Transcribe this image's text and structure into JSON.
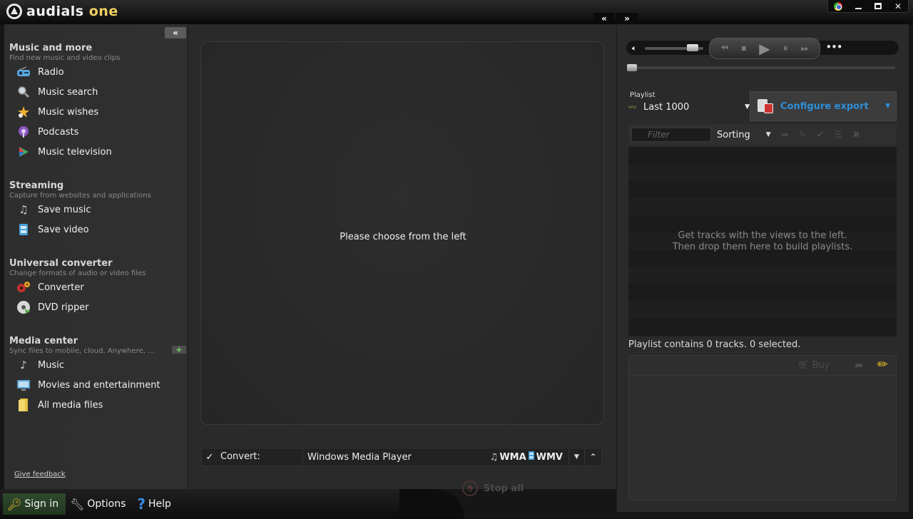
{
  "app": {
    "title_main": "audials",
    "title_accent": "one"
  },
  "window_controls": {
    "minimize": "minimize",
    "maximize": "maximize",
    "close": "✕"
  },
  "panel_toggles": {
    "left": "«",
    "right": "»",
    "sidebar_collapse": "«"
  },
  "sidebar": {
    "sections": [
      {
        "title": "Music and more",
        "subtitle": "Find new music and video clips",
        "items": [
          {
            "label": "Radio",
            "icon": "radio-icon"
          },
          {
            "label": "Music search",
            "icon": "magnifier-icon"
          },
          {
            "label": "Music wishes",
            "icon": "wishes-icon"
          },
          {
            "label": "Podcasts",
            "icon": "podcast-icon"
          },
          {
            "label": "Music television",
            "icon": "tv-play-icon"
          }
        ]
      },
      {
        "title": "Streaming",
        "subtitle": "Capture from websites and applications",
        "items": [
          {
            "label": "Save music",
            "icon": "music-note-icon"
          },
          {
            "label": "Save video",
            "icon": "film-icon"
          }
        ]
      },
      {
        "title": "Universal converter",
        "subtitle": "Change formats of audio or video files",
        "items": [
          {
            "label": "Converter",
            "icon": "converter-icon"
          },
          {
            "label": "DVD ripper",
            "icon": "dvd-icon"
          }
        ]
      },
      {
        "title": "Media center",
        "subtitle": "Sync files to mobile, cloud, Anywhere, ...",
        "add_label": "+",
        "items": [
          {
            "label": "Music",
            "icon": "music-note-icon"
          },
          {
            "label": "Movies and entertainment",
            "icon": "monitor-icon"
          },
          {
            "label": "All media files",
            "icon": "folder-icon"
          }
        ]
      }
    ],
    "feedback": "Give feedback"
  },
  "bottom_bar": {
    "sign_in": "Sign in",
    "options": "Options",
    "help": "Help"
  },
  "center": {
    "message": "Please choose from the left",
    "convert": {
      "checked": "✓",
      "label": "Convert:",
      "target": "Windows Media Player",
      "format_audio": "WMA",
      "format_video": "WMV"
    },
    "stop_all": "Stop all"
  },
  "player": {
    "volume_level": 0.9,
    "seek_position": 0.0
  },
  "playlist": {
    "caption": "Playlist",
    "selected": "Last 1000",
    "export_label": "Configure export",
    "filter_placeholder": "Filter",
    "sorting_label": "Sorting",
    "empty_line1": "Get tracks with the views to the left.",
    "empty_line2": "Then drop them here to build playlists.",
    "status": "Playlist contains 0 tracks. 0 selected.",
    "buy_label": "Buy"
  },
  "colors": {
    "accent_blue": "#2e8fd8",
    "brand_yellow": "#f0d060",
    "signin_green": "#2f4a2d"
  }
}
